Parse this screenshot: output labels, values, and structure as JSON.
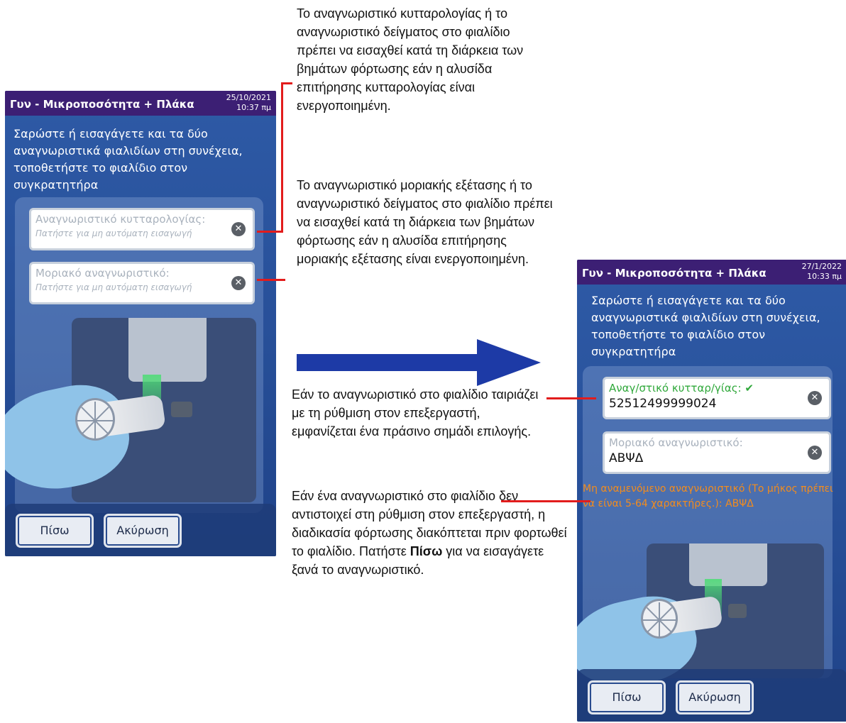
{
  "screen1": {
    "title": "Γυν - Μικροποσότητα + Πλάκα",
    "date": "25/10/2021",
    "time": "10:37 πμ",
    "instruction": "Σαρώστε ή εισαγάγετε και τα δύο αναγνωριστικά φιαλιδίων στη συνέχεια, τοποθετήστε το φιαλίδιο στον συγκρατητήρα",
    "field1_label": "Αναγνωριστικό κυτταρολογίας:",
    "field1_hint": "Πατήστε για μη αυτόματη εισαγωγή",
    "field2_label": "Μοριακό αναγνωριστικό:",
    "field2_hint": "Πατήστε για μη αυτόματη εισαγωγή",
    "back_label": "Πίσω",
    "cancel_label": "Ακύρωση"
  },
  "screen2": {
    "title": "Γυν - Μικροποσότητα + Πλάκα",
    "date": "27/1/2022",
    "time": "10:33 πμ",
    "instruction": "Σαρώστε ή εισαγάγετε και τα δύο αναγνωριστικά φιαλιδίων στη συνέχεια, τοποθετήστε το φιαλίδιο στον συγκρατητήρα",
    "field1_label": "Αναγ/στικό κυτταρ/γίας: ✔",
    "field1_value": "52512499999024",
    "field2_label": "Μοριακό αναγνωριστικό:",
    "field2_value": "ΑΒΨΔ",
    "error": "Μη αναμενόμενο αναγνωριστικό (Το μήκος πρέπει να είναι 5-64 χαρακτήρες.): ΑΒΨΔ",
    "back_label": "Πίσω",
    "cancel_label": "Ακύρωση"
  },
  "annotations": {
    "note_cytology": "Το αναγνωριστικό κυτταρολογίας ή το αναγνωριστικό δείγματος στο φιαλίδιο πρέπει να εισαχθεί κατά τη διάρκεια των βημάτων φόρτωσης εάν η αλυσίδα επιτήρησης κυτταρολογίας είναι ενεργοποιημένη.",
    "note_molecular": "Το αναγνωριστικό μοριακής εξέτασης ή το αναγνωριστικό δείγματος στο φιαλίδιο πρέπει να εισαχθεί κατά τη διάρκεια των βημάτων φόρτωσης εάν η αλυσίδα επιτήρησης μοριακής εξέτασης είναι ενεργοποιημένη.",
    "note_match": "Εάν το αναγνωριστικό στο φιαλίδιο ταιριάζει με τη ρύθμιση στον επεξεργαστή, εμφανίζεται ένα πράσινο σημάδι επιλογής.",
    "note_mismatch_pre": "Εάν ένα αναγνωριστικό στο φιαλίδιο δεν αντιστοιχεί στη ρύθμιση στον επεξεργαστή, η διαδικασία φόρτωσης διακόπτεται πριν φορτωθεί το φιαλίδιο. Πατήστε ",
    "note_mismatch_bold": "Πίσω",
    "note_mismatch_post": " για να εισαγάγετε ξανά το αναγνωριστικό."
  },
  "colors": {
    "titlebar": "#3c1f74",
    "screen_bg": "#2b56a0",
    "callout_line": "#e21c1c",
    "flow_arrow": "#1d3aa6",
    "ok_green": "#2fa83a",
    "error_orange": "#f28c1e"
  }
}
